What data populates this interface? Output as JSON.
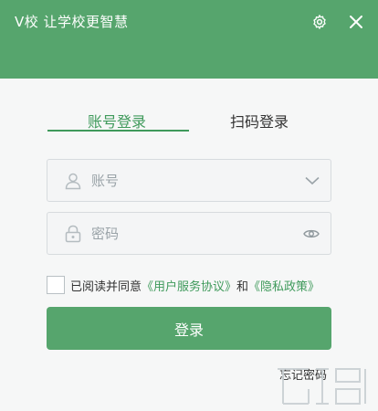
{
  "window": {
    "title": "V校 让学校更智慧",
    "settings_icon": "gear-icon",
    "close_icon": "close-icon"
  },
  "tabs": [
    {
      "label": "账号登录",
      "active": true
    },
    {
      "label": "扫码登录",
      "active": false
    }
  ],
  "form": {
    "account_placeholder": "账号",
    "account_value": "",
    "password_placeholder": "密码",
    "password_value": ""
  },
  "agreement": {
    "checked": false,
    "prefix": "已阅读并同意",
    "user_agreement": "《用户服务协议》",
    "and": "和",
    "privacy_policy": "《隐私政策》"
  },
  "login_button": "登录",
  "forgot_password": "忘记密码",
  "colors": {
    "brand": "#56a56d",
    "accent_text": "#3f9a5b",
    "panel_bg": "#f6f7f7"
  }
}
